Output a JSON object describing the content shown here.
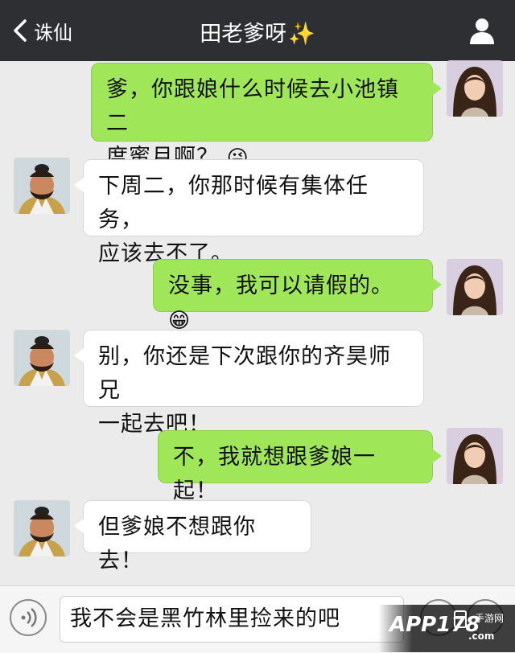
{
  "header": {
    "back_label": "诛仙",
    "title": "田老爹呀",
    "title_emoji": "✨"
  },
  "messages": [
    {
      "side": "out",
      "text_lines": [
        "爹，你跟娘什么时候去小池镇二",
        "度蜜月啊？"
      ],
      "emoji": "😜"
    },
    {
      "side": "in",
      "text_lines": [
        "下周二，你那时候有集体任务，",
        "应该去不了。"
      ]
    },
    {
      "side": "out",
      "text_lines": [
        "没事，我可以请假的。"
      ],
      "emoji": "😁"
    },
    {
      "side": "in",
      "text_lines": [
        "别，你还是下次跟你的齐昊师兄",
        "一起去吧！"
      ]
    },
    {
      "side": "out",
      "text_lines": [
        "不，我就想跟爹娘一起！"
      ]
    },
    {
      "side": "in",
      "text_lines": [
        "但爹娘不想跟你去！"
      ]
    }
  ],
  "input": {
    "value": "我不会是黑竹林里捡来的吧"
  },
  "watermark": {
    "main": "APP178",
    "sub": ".com",
    "sub2": "手游网"
  },
  "colors": {
    "topbar": "#2e2f33",
    "bubble_out": "#9fe659",
    "bubble_in": "#ffffff",
    "background": "#ebebeb"
  }
}
